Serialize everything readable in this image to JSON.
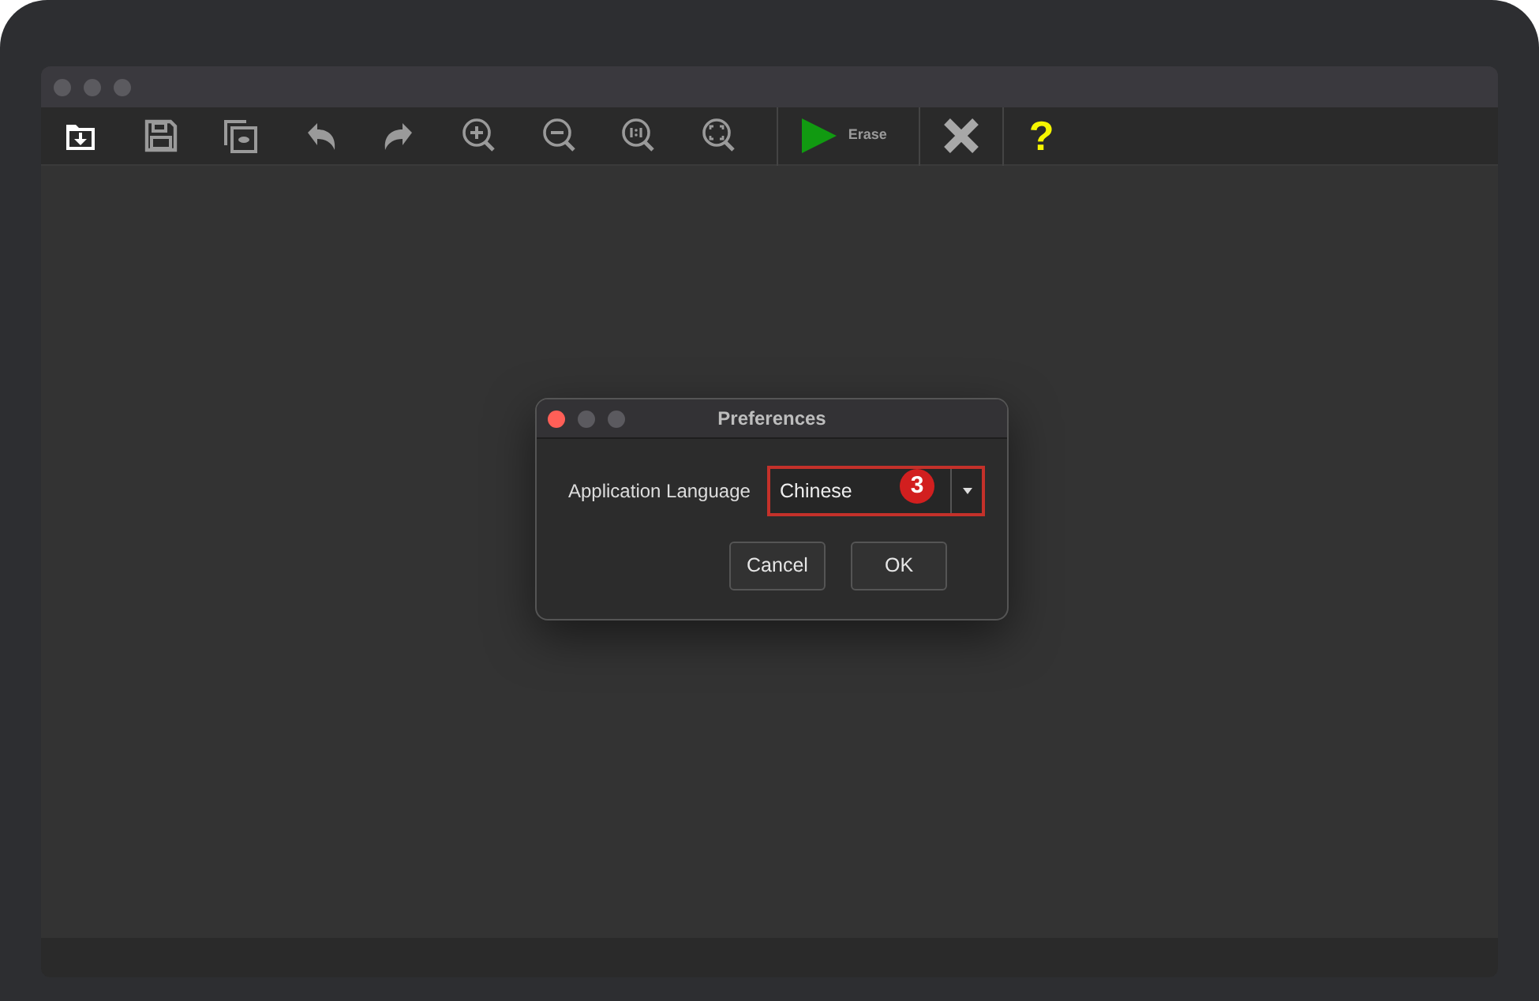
{
  "toolbar": {
    "erase_button": {
      "label": "Erase"
    },
    "help_button": {
      "label": "?"
    }
  },
  "dialog": {
    "title": "Preferences",
    "field_label": "Application Language",
    "language_select": {
      "value": "Chinese",
      "badge": "3"
    },
    "buttons": [
      {
        "label": "Cancel"
      },
      {
        "label": "OK"
      }
    ]
  }
}
